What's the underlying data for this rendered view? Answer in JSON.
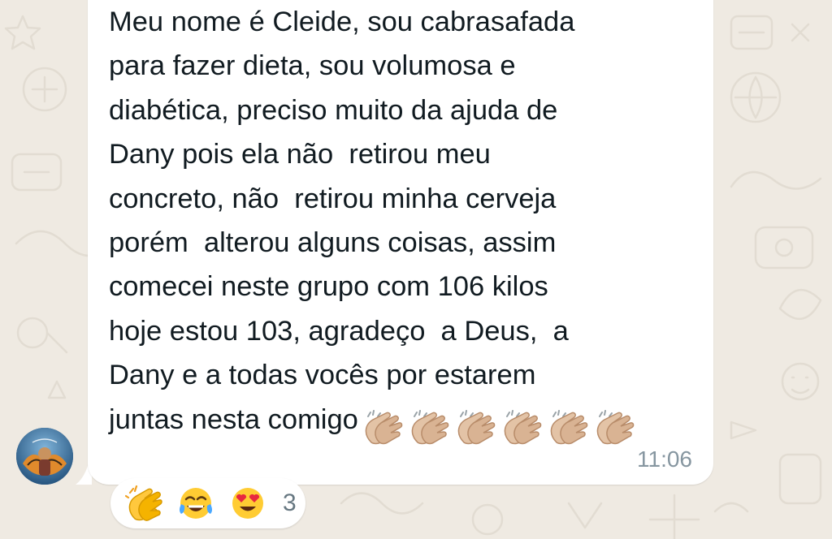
{
  "message": {
    "lines": [
      "Meu nome é Cleide, sou cabrasafada",
      "para fazer dieta, sou volumosa e",
      "diabética, preciso muito da ajuda de",
      "Dany pois ela não  retirou meu",
      "concreto, não  retirou minha cerveja",
      "porém  alterou alguns coisas, assim",
      "comecei neste grupo com 106 kilos",
      "hoje estou 103, agradeço  a Deus,  a",
      "Dany e a todas vocês por estarem",
      "juntas nesta comigo"
    ],
    "trailing_emoji": "clapping-hands-icon",
    "trailing_emoji_count": 6,
    "timestamp": "11:06"
  },
  "sender": {
    "avatar_icon": "sender-avatar"
  },
  "reactions": {
    "emojis": [
      "clapping-hands-icon",
      "tears-of-joy-icon",
      "heart-eyes-icon"
    ],
    "count": "3"
  },
  "colors": {
    "background": "#efeae2",
    "bubble": "#ffffff",
    "text": "#111b21",
    "meta_text": "#8696a0"
  }
}
